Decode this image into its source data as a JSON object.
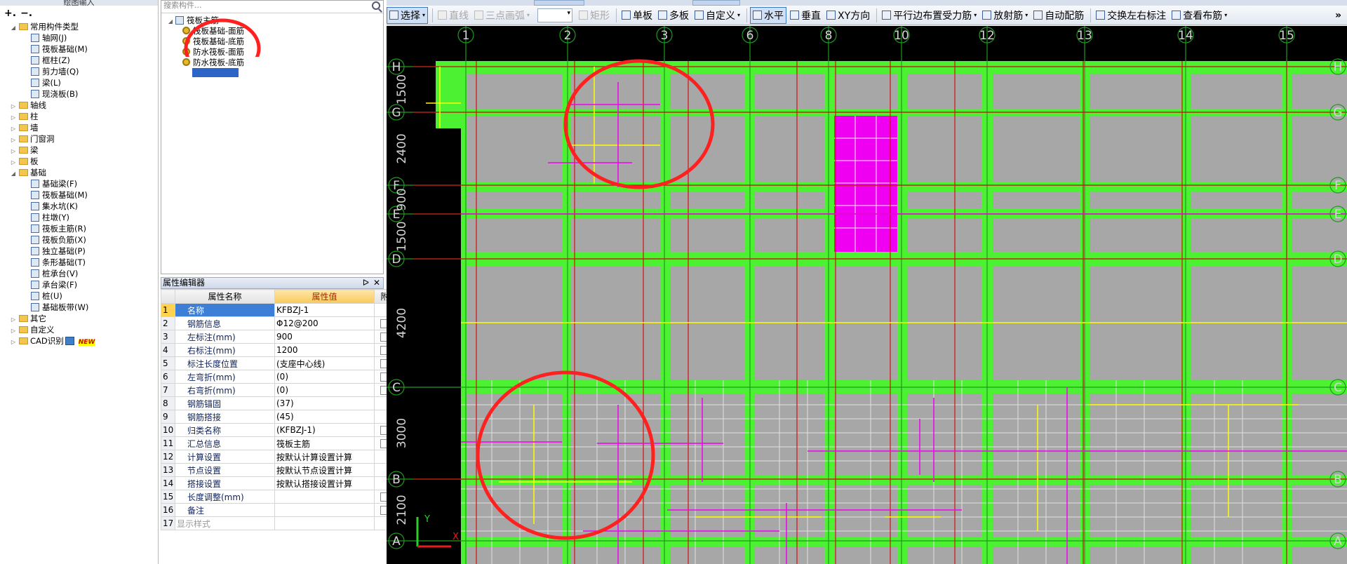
{
  "nav": {
    "title": "绘图输入",
    "tree": [
      {
        "label": "常用构件类型",
        "level": 0,
        "type": "folder",
        "open": true
      },
      {
        "label": "轴网(J)",
        "level": 1,
        "type": "icon"
      },
      {
        "label": "筏板基础(M)",
        "level": 1,
        "type": "icon"
      },
      {
        "label": "框柱(Z)",
        "level": 1,
        "type": "icon"
      },
      {
        "label": "剪力墙(Q)",
        "level": 1,
        "type": "icon"
      },
      {
        "label": "梁(L)",
        "level": 1,
        "type": "icon"
      },
      {
        "label": "现浇板(B)",
        "level": 1,
        "type": "icon"
      },
      {
        "label": "轴线",
        "level": 0,
        "type": "folder",
        "open": false
      },
      {
        "label": "柱",
        "level": 0,
        "type": "folder",
        "open": false
      },
      {
        "label": "墙",
        "level": 0,
        "type": "folder",
        "open": false
      },
      {
        "label": "门窗洞",
        "level": 0,
        "type": "folder",
        "open": false
      },
      {
        "label": "梁",
        "level": 0,
        "type": "folder",
        "open": false
      },
      {
        "label": "板",
        "level": 0,
        "type": "folder",
        "open": false
      },
      {
        "label": "基础",
        "level": 0,
        "type": "folder",
        "open": true
      },
      {
        "label": "基础梁(F)",
        "level": 1,
        "type": "icon"
      },
      {
        "label": "筏板基础(M)",
        "level": 1,
        "type": "icon"
      },
      {
        "label": "集水坑(K)",
        "level": 1,
        "type": "icon"
      },
      {
        "label": "柱墩(Y)",
        "level": 1,
        "type": "icon"
      },
      {
        "label": "筏板主筋(R)",
        "level": 1,
        "type": "icon"
      },
      {
        "label": "筏板负筋(X)",
        "level": 1,
        "type": "icon"
      },
      {
        "label": "独立基础(P)",
        "level": 1,
        "type": "icon"
      },
      {
        "label": "条形基础(T)",
        "level": 1,
        "type": "icon"
      },
      {
        "label": "桩承台(V)",
        "level": 1,
        "type": "icon"
      },
      {
        "label": "承台梁(F)",
        "level": 1,
        "type": "icon"
      },
      {
        "label": "桩(U)",
        "level": 1,
        "type": "icon"
      },
      {
        "label": "基础板带(W)",
        "level": 1,
        "type": "icon"
      },
      {
        "label": "其它",
        "level": 0,
        "type": "folder",
        "open": false
      },
      {
        "label": "自定义",
        "level": 0,
        "type": "folder",
        "open": false
      },
      {
        "label": "CAD识别",
        "level": 0,
        "type": "folder",
        "open": false,
        "badge": "NEW"
      }
    ]
  },
  "components": {
    "search_placeholder": "搜索构件...",
    "root": "筏板主筋",
    "items": [
      "筏板基础-面筋",
      "筏板基础-底筋",
      "防水筏板-面筋",
      "防水筏板-底筋"
    ]
  },
  "props": {
    "title": "属性编辑器",
    "headers": [
      "属性名称",
      "属性值",
      "附"
    ],
    "rows": [
      {
        "n": "1",
        "name": "名称",
        "value": "KFBZJ-1",
        "cb": false
      },
      {
        "n": "2",
        "name": "钢筋信息",
        "value": "Φ12@200",
        "cb": true
      },
      {
        "n": "3",
        "name": "左标注(mm)",
        "value": "900",
        "cb": true
      },
      {
        "n": "4",
        "name": "右标注(mm)",
        "value": "1200",
        "cb": true
      },
      {
        "n": "5",
        "name": "标注长度位置",
        "value": "(支座中心线)",
        "cb": true
      },
      {
        "n": "6",
        "name": "左弯折(mm)",
        "value": "(0)",
        "cb": true
      },
      {
        "n": "7",
        "name": "右弯折(mm)",
        "value": "(0)",
        "cb": true
      },
      {
        "n": "8",
        "name": "钢筋锚固",
        "value": "(37)",
        "cb": false
      },
      {
        "n": "9",
        "name": "钢筋搭接",
        "value": "(45)",
        "cb": false
      },
      {
        "n": "10",
        "name": "归类名称",
        "value": "(KFBZJ-1)",
        "cb": true
      },
      {
        "n": "11",
        "name": "汇总信息",
        "value": "筏板主筋",
        "cb": true
      },
      {
        "n": "12",
        "name": "计算设置",
        "value": "按默认计算设置计算",
        "cb": false
      },
      {
        "n": "13",
        "name": "节点设置",
        "value": "按默认节点设置计算",
        "cb": false
      },
      {
        "n": "14",
        "name": "搭接设置",
        "value": "按默认搭接设置计算",
        "cb": false
      },
      {
        "n": "15",
        "name": "长度调整(mm)",
        "value": "",
        "cb": true
      },
      {
        "n": "16",
        "name": "备注",
        "value": "",
        "cb": true
      },
      {
        "n": "17",
        "name": "显示样式",
        "value": "",
        "cb": false
      }
    ]
  },
  "toolbar": [
    {
      "label": "选择",
      "dropdown": true,
      "active": true
    },
    {
      "label": "直线",
      "disabled": true
    },
    {
      "label": "三点画弧",
      "disabled": true,
      "dropdown": true
    },
    {
      "label": "矩形",
      "disabled": true
    },
    {
      "label": "单板"
    },
    {
      "label": "多板"
    },
    {
      "label": "自定义",
      "dropdown": true
    },
    {
      "label": "水平",
      "active": true
    },
    {
      "label": "垂直"
    },
    {
      "label": "XY方向"
    },
    {
      "label": "平行边布置受力筋",
      "dropdown": true
    },
    {
      "label": "放射筋",
      "dropdown": true
    },
    {
      "label": "自动配筋"
    },
    {
      "label": "交换左右标注"
    },
    {
      "label": "查看布筋",
      "dropdown": true
    }
  ],
  "more_glyph": "»",
  "canvas": {
    "x_axes": [
      "1",
      "2",
      "3",
      "6",
      "8",
      "10",
      "12",
      "13",
      "14",
      "15"
    ],
    "y_axes": [
      "H",
      "G",
      "F",
      "E",
      "D",
      "C",
      "B",
      "A"
    ],
    "dims": [
      "1500",
      "2400",
      "900",
      "1500",
      "4200",
      "3000",
      "2100"
    ],
    "ucs_y": "Y",
    "ucs_x": "X",
    "colors": {
      "green": "#4cf132",
      "gray": "#a7a7a7",
      "red": "#d21010",
      "magenta": "#f000f0",
      "yellow": "#ffff00",
      "axisline": "#1d9a1d",
      "highlight": "#ff2020"
    }
  }
}
